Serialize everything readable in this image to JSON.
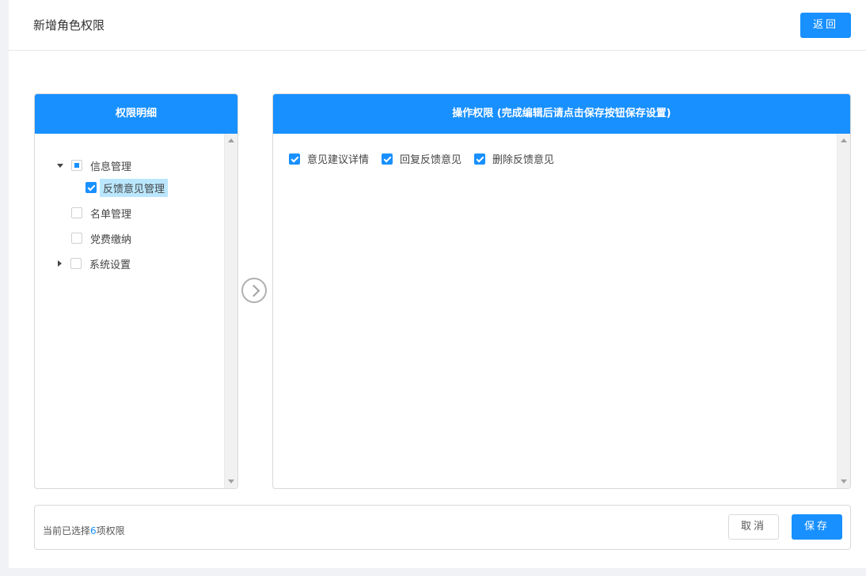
{
  "header": {
    "title": "新增角色权限",
    "back_label": "返回"
  },
  "left_panel": {
    "title": "权限明细",
    "tree": [
      {
        "label": "信息管理",
        "state": "partial",
        "expanded": true,
        "children": [
          {
            "label": "反馈意见管理",
            "state": "checked",
            "selected": true
          }
        ]
      },
      {
        "label": "名单管理",
        "state": "unchecked"
      },
      {
        "label": "党费缴纳",
        "state": "unchecked"
      },
      {
        "label": "系统设置",
        "state": "unchecked",
        "expanded": false
      }
    ]
  },
  "right_panel": {
    "title": "操作权限 (完成编辑后请点击保存按钮保存设置)",
    "permissions": [
      {
        "label": "意见建议详情",
        "checked": true
      },
      {
        "label": "回复反馈意见",
        "checked": true
      },
      {
        "label": "删除反馈意见",
        "checked": true
      }
    ]
  },
  "footer": {
    "selected_prefix": "当前已选择",
    "selected_count": "6",
    "selected_suffix": "项权限",
    "cancel_label": "取消",
    "save_label": "保存"
  },
  "colors": {
    "primary": "#1890ff",
    "selected_bg": "#bae7ff"
  }
}
